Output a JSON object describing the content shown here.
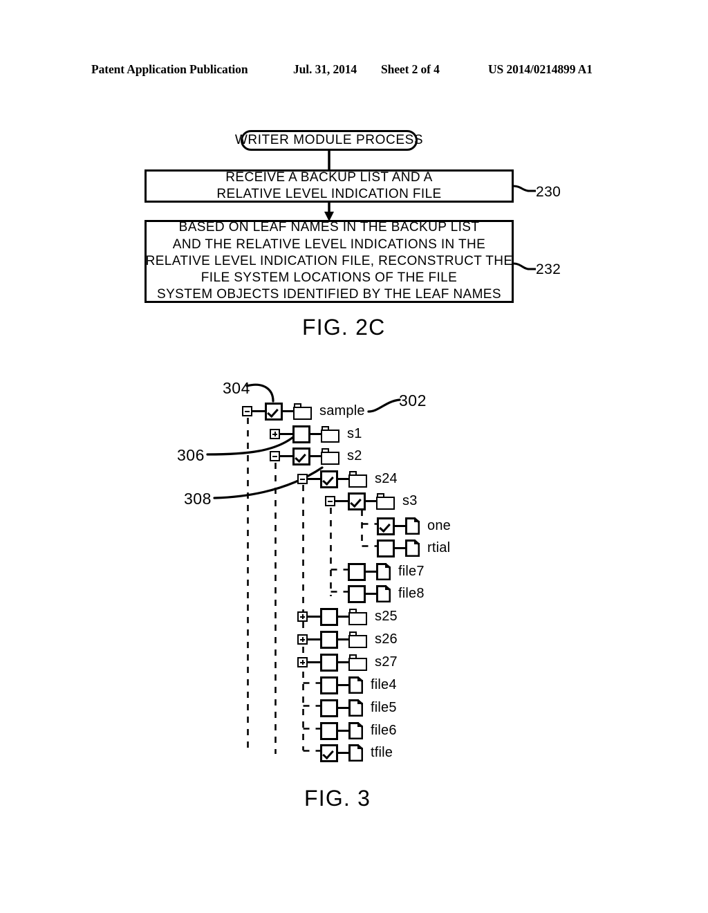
{
  "header": {
    "publication": "Patent Application Publication",
    "date": "Jul. 31, 2014",
    "sheet": "Sheet 2 of 4",
    "patent_number": "US 2014/0214899 A1"
  },
  "figure_2c": {
    "label": "FIG. 2C",
    "terminal": {
      "text": "WRITER MODULE PROCESS",
      "shape": "rounded-terminal"
    },
    "steps": [
      {
        "ref": "230",
        "lines": [
          "RECEIVE A BACKUP LIST AND A",
          "RELATIVE LEVEL INDICATION  FILE"
        ]
      },
      {
        "ref": "232",
        "lines": [
          "BASED ON LEAF NAMES IN THE BACKUP LIST",
          "AND THE RELATIVE LEVEL INDICATIONS IN THE",
          "RELATIVE LEVEL INDICATION FILE, RECONSTRUCT THE",
          "FILE SYSTEM LOCATIONS OF THE FILE",
          "SYSTEM OBJECTS IDENTIFIED BY THE LEAF NAMES"
        ]
      }
    ],
    "ref_labels": {
      "step1": "230",
      "step2": "232"
    }
  },
  "figure_3": {
    "label": "FIG. 3",
    "leader_numbers": {
      "tree": "302",
      "checkbox": "304",
      "collapsed_node": "306",
      "expander": "308"
    },
    "tree_nodes": [
      {
        "label": "sample",
        "depth": 0,
        "icon": "folder-icon",
        "expander": "minus",
        "checkbox": "checked"
      },
      {
        "label": "s1",
        "depth": 1,
        "icon": "folder-icon",
        "expander": "plus",
        "checkbox": "unchecked"
      },
      {
        "label": "s2",
        "depth": 1,
        "icon": "folder-icon",
        "expander": "minus",
        "checkbox": "checked"
      },
      {
        "label": "s24",
        "depth": 2,
        "icon": "folder-icon",
        "expander": "minus",
        "checkbox": "checked"
      },
      {
        "label": "s3",
        "depth": 3,
        "icon": "folder-icon",
        "expander": "minus",
        "checkbox": "checked"
      },
      {
        "label": "one",
        "depth": 4,
        "icon": "file-icon",
        "expander": "none",
        "checkbox": "checked"
      },
      {
        "label": "rtial",
        "depth": 4,
        "icon": "file-icon",
        "expander": "none",
        "checkbox": "unchecked"
      },
      {
        "label": "file7",
        "depth": 3,
        "icon": "file-icon",
        "expander": "none",
        "checkbox": "unchecked"
      },
      {
        "label": "file8",
        "depth": 3,
        "icon": "file-icon",
        "expander": "none",
        "checkbox": "unchecked"
      },
      {
        "label": "s25",
        "depth": 2,
        "icon": "folder-icon",
        "expander": "plus",
        "checkbox": "unchecked"
      },
      {
        "label": "s26",
        "depth": 2,
        "icon": "folder-icon",
        "expander": "plus",
        "checkbox": "unchecked"
      },
      {
        "label": "s27",
        "depth": 2,
        "icon": "folder-icon",
        "expander": "plus",
        "checkbox": "unchecked"
      },
      {
        "label": "file4",
        "depth": 2,
        "icon": "file-icon",
        "expander": "none",
        "checkbox": "unchecked"
      },
      {
        "label": "file5",
        "depth": 2,
        "icon": "file-icon",
        "expander": "none",
        "checkbox": "unchecked"
      },
      {
        "label": "file6",
        "depth": 2,
        "icon": "file-icon",
        "expander": "none",
        "checkbox": "unchecked"
      },
      {
        "label": "tfile",
        "depth": 2,
        "icon": "file-icon",
        "expander": "none",
        "checkbox": "checked"
      }
    ]
  },
  "colors": {
    "ink": "#000000",
    "paper": "#ffffff"
  }
}
